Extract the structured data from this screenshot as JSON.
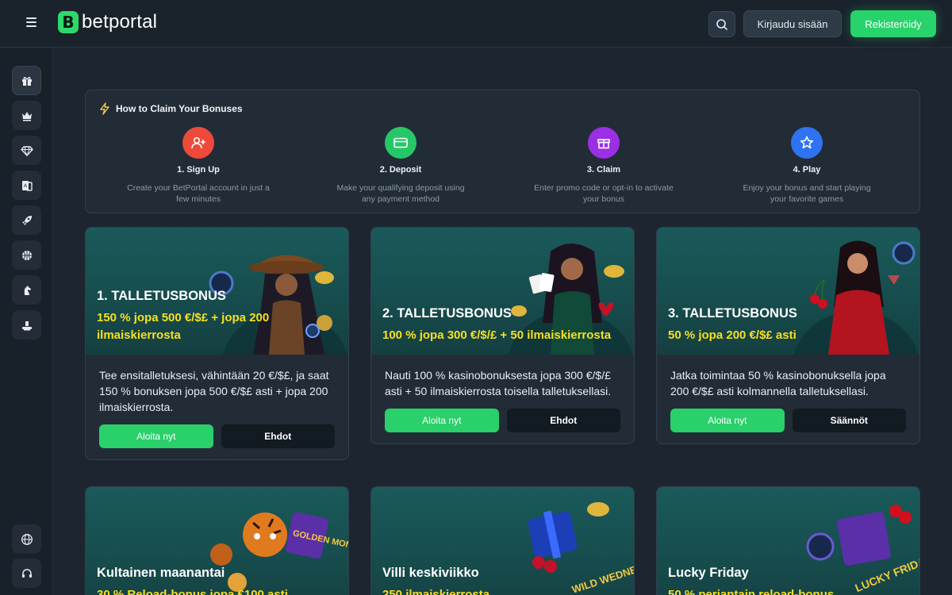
{
  "header": {
    "brand": "betportal",
    "brand_mark": "B",
    "login_label": "Kirjaudu sisään",
    "register_label": "Rekisteröidy"
  },
  "sidebar": {
    "items": [
      {
        "icon": "gift-icon"
      },
      {
        "icon": "crown-icon"
      },
      {
        "icon": "diamond-icon"
      },
      {
        "icon": "cards-icon"
      },
      {
        "icon": "rocket-icon"
      },
      {
        "icon": "basketball-icon"
      },
      {
        "icon": "horse-icon"
      },
      {
        "icon": "poker-table-icon"
      }
    ],
    "bottom_items": [
      {
        "icon": "globe-icon"
      },
      {
        "icon": "headset-icon"
      }
    ]
  },
  "claim": {
    "title": "How to Claim Your Bonuses",
    "steps": [
      {
        "title": "1. Sign Up",
        "desc": "Create your BetPortal account in just a few minutes",
        "color": "#ee4a3b",
        "icon": "user-plus-icon"
      },
      {
        "title": "2. Deposit",
        "desc": "Make your qualifying deposit using any payment method",
        "color": "#26c768",
        "icon": "credit-card-icon"
      },
      {
        "title": "3. Claim",
        "desc": "Enter promo code or opt-in to activate your bonus",
        "color": "#9b2fe6",
        "icon": "gift-box-icon"
      },
      {
        "title": "4. Play",
        "desc": "Enjoy your bonus and start playing your favorite games",
        "color": "#2f73f2",
        "icon": "star-icon"
      }
    ]
  },
  "bonuses": [
    {
      "title": "1. TALLETUSBONUS",
      "subtitle": "150 % jopa 500 €/$£ + jopa 200 ilmaiskierrosta",
      "text": "Tee ensitalletuksesi, vähintään 20 €/$£, ja saat 150 % bonuksen jopa 500 €/$£ asti + jopa 200 ilmaiskierrosta.",
      "primary": "Aloita nyt",
      "secondary": "Ehdot"
    },
    {
      "title": "2. TALLETUSBONUS",
      "subtitle": "100 % jopa 300 €/$/£ + 50 ilmaiskierrosta",
      "text": "Nauti 100 % kasinobonuksesta jopa 300 €/$/£ asti + 50 ilmaiskierrosta toisella talletuksellasi.",
      "primary": "Aloita nyt",
      "secondary": "Ehdot"
    },
    {
      "title": "3. TALLETUSBONUS",
      "subtitle": "50 % jopa 200 €/$£ asti",
      "text": "Jatka toimintaa 50 % kasinobonuksella jopa 200 €/$£ asti kolmannella talletuksellasi.",
      "primary": "Aloita nyt",
      "secondary": "Säännöt"
    }
  ],
  "promos": [
    {
      "title": "Kultainen maanantai",
      "subtitle": "30 % Reload-bonus jopa €100 asti",
      "badge": "GOLDEN MONDAY"
    },
    {
      "title": "Villi keskiviikko",
      "subtitle": "250 ilmaiskierrosta",
      "badge": "WILD WEDNESDAY"
    },
    {
      "title": "Lucky Friday",
      "subtitle": "50 % perjantain reload-bonus",
      "badge": "LUCKY FRIDAY"
    }
  ]
}
